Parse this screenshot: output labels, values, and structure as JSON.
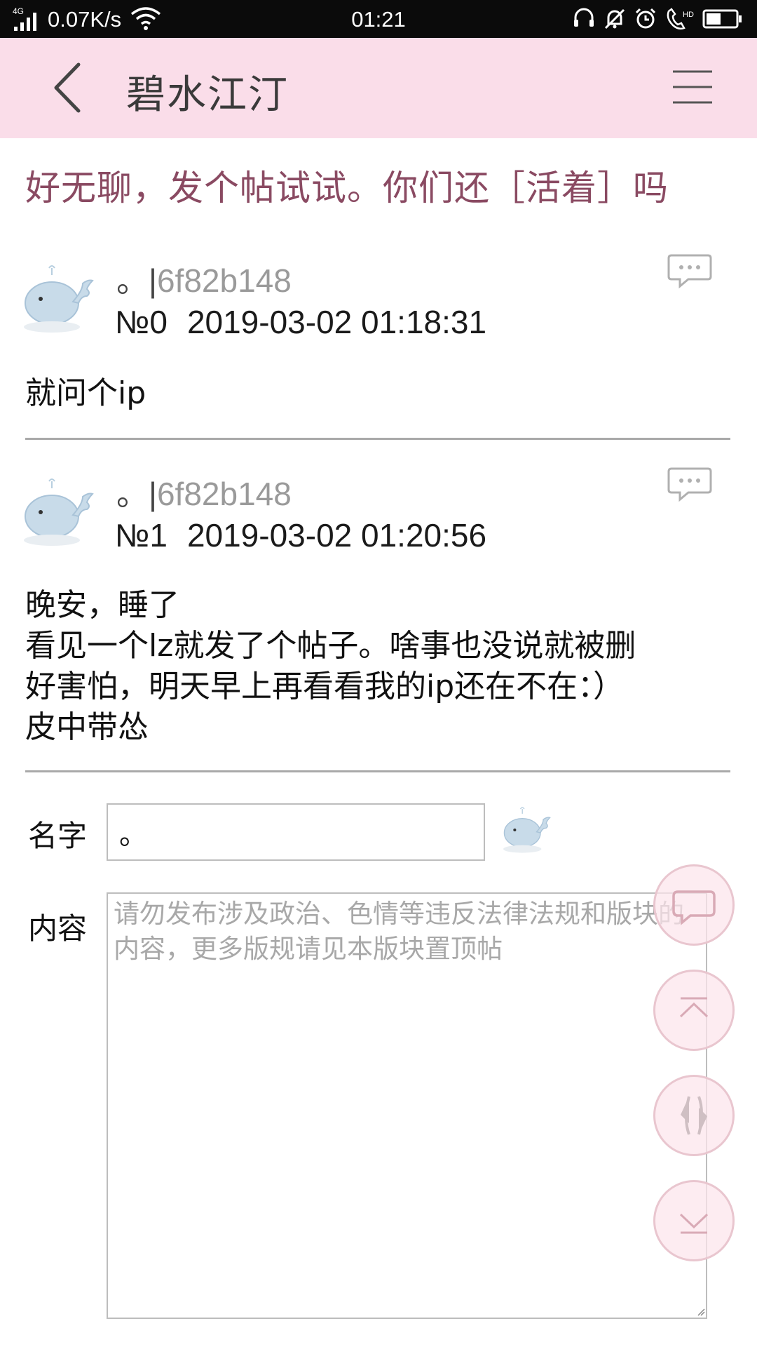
{
  "status_bar": {
    "network": "4G",
    "speed": "0.07K/s",
    "time": "01:21"
  },
  "header": {
    "title": "碧水江汀"
  },
  "thread": {
    "title": "好无聊，发个帖试试。你们还［活着］吗"
  },
  "posts": [
    {
      "name_prefix": "。|",
      "name_id": "6f82b148",
      "floor": "№0",
      "datetime": "2019-03-02 01:18:31",
      "lines": [
        "就问个ip"
      ]
    },
    {
      "name_prefix": "。|",
      "name_id": "6f82b148",
      "floor": "№1",
      "datetime": "2019-03-02 01:20:56",
      "lines": [
        "晚安，睡了",
        "看见一个lz就发了个帖子。啥事也没说就被删",
        "好害怕，明天早上再看看我的ip还在不在：）",
        "皮中带怂"
      ]
    }
  ],
  "form": {
    "name_label": "名字",
    "name_value": "。",
    "content_label": "内容",
    "content_placeholder": "请勿发布涉及政治、色情等违反法律法规和版块的内容，更多版规请见本版块置顶帖"
  },
  "colors": {
    "header_bg": "#fadde9",
    "thread_title": "#8a4a62",
    "fab_border": "#e9c6cf",
    "status_bar_bg": "#0b0b0b"
  },
  "icons": {
    "back": "chevron-left-icon",
    "menu": "hamburger-menu-icon",
    "reply": "speech-bubble-icon",
    "avatar": "whale-icon",
    "fab_comment": "comment-icon",
    "fab_top": "scroll-top-icon",
    "fab_refresh": "refresh-icon",
    "fab_bottom": "scroll-bottom-icon"
  }
}
